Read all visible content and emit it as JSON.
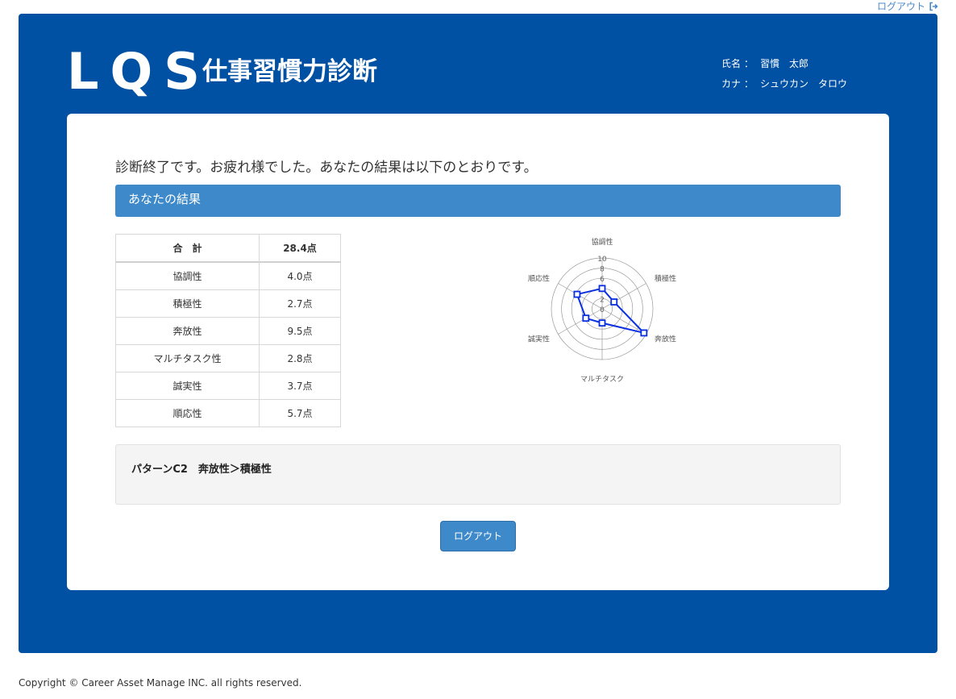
{
  "header": {
    "top_logout_label": "ログアウト",
    "logo": "LQS",
    "app_title": "仕事習慣力診断",
    "user": {
      "name_label": "氏名 ：",
      "name_value": "習慣　太郎",
      "kana_label": "カナ ：",
      "kana_value": "シュウカン　タロウ"
    }
  },
  "main": {
    "message": "診断終了です。お疲れ様でした。あなたの結果は以下のとおりです。",
    "result_header": "あなたの結果",
    "table": {
      "total_label": "合　計",
      "total_value": "28.4点",
      "rows": [
        {
          "label": "協調性",
          "value": "4.0点"
        },
        {
          "label": "積極性",
          "value": "2.7点"
        },
        {
          "label": "奔放性",
          "value": "9.5点"
        },
        {
          "label": "マルチタスク性",
          "value": "2.8点"
        },
        {
          "label": "誠実性",
          "value": "3.7点"
        },
        {
          "label": "順応性",
          "value": "5.7点"
        }
      ]
    },
    "pattern": "パターンC2　奔放性＞積極性",
    "logout_button": "ログアウト"
  },
  "chart_data": {
    "type": "radar",
    "categories": [
      "協調性",
      "積極性",
      "奔放性",
      "マルチタスク",
      "誠実性",
      "順応性"
    ],
    "values": [
      4.0,
      2.7,
      9.5,
      2.8,
      3.7,
      5.7
    ],
    "rlim": [
      0,
      10
    ],
    "ticks": [
      "0",
      "2",
      "4",
      "6",
      "8",
      "10"
    ],
    "line_color": "#0a2fe0"
  },
  "footer": {
    "copyright": "Copyright © Career Asset Manage INC. all rights reserved."
  }
}
